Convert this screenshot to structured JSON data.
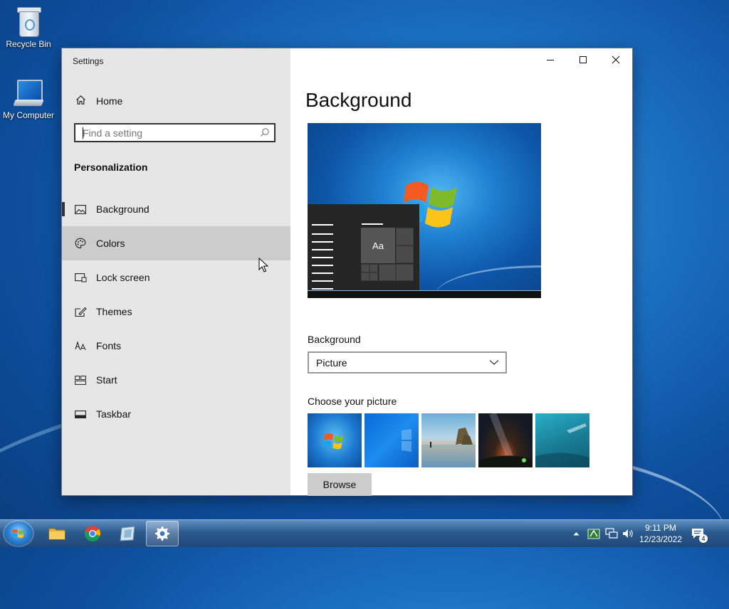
{
  "desktop": {
    "icons": [
      {
        "label": "Recycle Bin",
        "icon": "recycle-bin-icon"
      },
      {
        "label": "My Computer",
        "icon": "computer-icon"
      }
    ]
  },
  "window": {
    "title": "Settings",
    "controls": {
      "minimize": "–",
      "maximize": "☐",
      "close": "✕"
    }
  },
  "nav": {
    "home_label": "Home",
    "search_placeholder": "Find a setting",
    "section_title": "Personalization",
    "items": [
      {
        "label": "Background",
        "icon": "picture-icon",
        "selected": true
      },
      {
        "label": "Colors",
        "icon": "palette-icon",
        "hovered": true
      },
      {
        "label": "Lock screen",
        "icon": "lock-screen-icon"
      },
      {
        "label": "Themes",
        "icon": "themes-icon"
      },
      {
        "label": "Fonts",
        "icon": "fonts-icon"
      },
      {
        "label": "Start",
        "icon": "start-icon"
      },
      {
        "label": "Taskbar",
        "icon": "taskbar-icon"
      }
    ]
  },
  "content": {
    "title": "Background",
    "preview_sample_text": "Aa",
    "background_label": "Background",
    "background_value": "Picture",
    "choose_picture_label": "Choose your picture",
    "browse_label": "Browse"
  },
  "taskbar": {
    "pinned": [
      "folder-icon",
      "chrome-icon",
      "window-app-icon",
      "settings-gear-icon"
    ],
    "active": "settings-gear-icon",
    "time": "9:11 PM",
    "date": "12/23/2022",
    "notification_count": "4"
  },
  "colors": {
    "accent": "#0078d7",
    "nav_bg": "#e6e6e6",
    "hover_bg": "#cccccc"
  }
}
